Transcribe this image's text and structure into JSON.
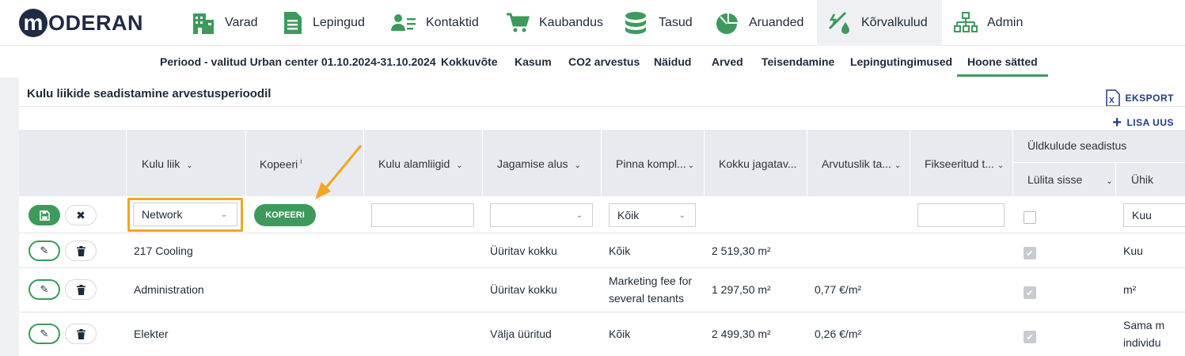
{
  "brand": {
    "logo_letter": "m",
    "logo_text": "ODERAN"
  },
  "nav": [
    {
      "label": "Varad",
      "icon": "building-icon"
    },
    {
      "label": "Lepingud",
      "icon": "document-icon"
    },
    {
      "label": "Kontaktid",
      "icon": "contacts-icon"
    },
    {
      "label": "Kaubandus",
      "icon": "cart-icon"
    },
    {
      "label": "Tasud",
      "icon": "coins-icon"
    },
    {
      "label": "Aruanded",
      "icon": "pie-chart-icon"
    },
    {
      "label": "Kõrvalkulud",
      "icon": "utilities-icon",
      "active": true
    },
    {
      "label": "Admin",
      "icon": "org-chart-icon"
    }
  ],
  "subnav": {
    "period": "Periood - valitud Urban center 01.10.2024-31.10.2024",
    "tabs": [
      "Kokkuvõte",
      "Kasum",
      "CO2 arvestus",
      "Näidud",
      "Arved",
      "Teisendamine",
      "Lepingutingimused",
      "Hoone sätted"
    ],
    "active": "Hoone sätted"
  },
  "panel": {
    "title": "Kulu liikide seadistamine arvestusperioodil",
    "export_label": "EKSPORT",
    "add_label": "LISA UUS"
  },
  "table": {
    "headers": {
      "kulu_liik": "Kulu liik",
      "kopeeri": "Kopeeri",
      "kopeeri_info": "i",
      "kulu_alamliigid": "Kulu alamliigid",
      "jagamise_alus": "Jagamise alus",
      "pinna_kompl": "Pinna kompl...",
      "kokku_jagatav": "Kokku jagatav...",
      "arvutuslik": "Arvutuslik ta...",
      "fikseeritud": "Fikseeritud t...",
      "yldkulud": "Üldkulude seadistus",
      "lylita_sisse": "Lülita sisse",
      "yhik": "Ühik"
    },
    "edit_row": {
      "kulu_liik": "Network",
      "kopeeri_button": "KOPEERI",
      "kulu_alamliigid": "",
      "jagamise_alus": "",
      "pinna_kompl": "Kõik",
      "fikseeritud": "",
      "yhik": "Kuu"
    },
    "rows": [
      {
        "kulu_liik": "217 Cooling",
        "jagamise_alus": "Üüritav kokku",
        "pinna_kompl": "Kõik",
        "kokku_jagatav": "2 519,30 m²",
        "arvutuslik": "",
        "yhik": "Kuu"
      },
      {
        "kulu_liik": "Administration",
        "jagamise_alus": "Üüritav kokku",
        "pinna_kompl": "Marketing fee for several tenants",
        "kokku_jagatav": "1 297,50 m²",
        "arvutuslik": "0,77 €/m²",
        "yhik": "m²"
      },
      {
        "kulu_liik": "Elekter",
        "jagamise_alus": "Välja üüritud",
        "pinna_kompl": "Kõik",
        "kokku_jagatav": "2 499,30 m²",
        "arvutuslik": "0,26 €/m²",
        "yhik": "Sama m individu"
      }
    ]
  },
  "colors": {
    "accent": "#3d9a5c",
    "brand": "#1f2a44",
    "highlight": "#f0a722",
    "link": "#1f3a8a"
  }
}
